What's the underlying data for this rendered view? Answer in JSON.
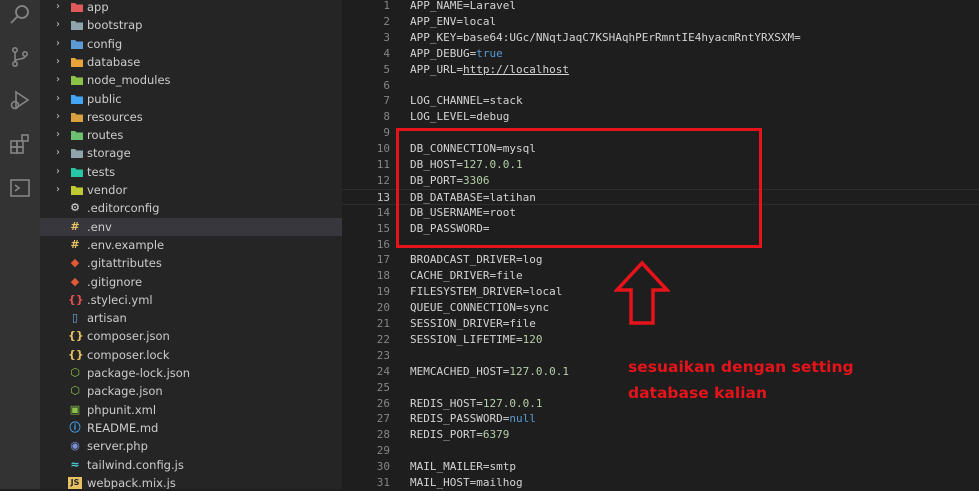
{
  "activity_bar": {
    "icons": [
      "search-icon",
      "source-control-icon",
      "run-debug-icon",
      "extensions-icon",
      "remote-explorer-icon"
    ]
  },
  "explorer": {
    "folders": [
      {
        "name": "app",
        "color": "#e05a5a"
      },
      {
        "name": "bootstrap",
        "color": "#90a4ae"
      },
      {
        "name": "config",
        "color": "#5c9bd6"
      },
      {
        "name": "database",
        "color": "#e8a33a"
      },
      {
        "name": "node_modules",
        "color": "#8bc34a"
      },
      {
        "name": "public",
        "color": "#42a5f5"
      },
      {
        "name": "resources",
        "color": "#d9a13e"
      },
      {
        "name": "routes",
        "color": "#6fbf73"
      },
      {
        "name": "storage",
        "color": "#90a4ae"
      },
      {
        "name": "tests",
        "color": "#26c6a6"
      },
      {
        "name": "vendor",
        "color": "#c0ca33"
      }
    ],
    "files": [
      {
        "name": ".editorconfig",
        "icon": "gear-icon",
        "color": "#e0e0e0",
        "glyph": "⚙"
      },
      {
        "name": ".env",
        "icon": "env-icon",
        "color": "#e8c163",
        "glyph": "#",
        "selected": true
      },
      {
        "name": ".env.example",
        "icon": "env-icon",
        "color": "#e8c163",
        "glyph": "#"
      },
      {
        "name": ".gitattributes",
        "icon": "git-icon",
        "color": "#e35935",
        "glyph": "◆"
      },
      {
        "name": ".gitignore",
        "icon": "git-icon",
        "color": "#e35935",
        "glyph": "◆"
      },
      {
        "name": ".styleci.yml",
        "icon": "yaml-icon",
        "color": "#e35050",
        "glyph": "{}"
      },
      {
        "name": "artisan",
        "icon": "file-icon",
        "color": "#6ea6dc",
        "glyph": "▯"
      },
      {
        "name": "composer.json",
        "icon": "json-icon",
        "color": "#e8c163",
        "glyph": "{}"
      },
      {
        "name": "composer.lock",
        "icon": "json-icon",
        "color": "#e8c163",
        "glyph": "{}"
      },
      {
        "name": "package-lock.json",
        "icon": "npm-icon",
        "color": "#8bc34a",
        "glyph": "⬡"
      },
      {
        "name": "package.json",
        "icon": "npm-icon",
        "color": "#8bc34a",
        "glyph": "⬡"
      },
      {
        "name": "phpunit.xml",
        "icon": "xml-icon",
        "color": "#8bc34a",
        "glyph": "▣"
      },
      {
        "name": "README.md",
        "icon": "info-icon",
        "color": "#42a5f5",
        "glyph": "ⓘ"
      },
      {
        "name": "server.php",
        "icon": "php-icon",
        "color": "#7b8fd6",
        "glyph": "◉"
      },
      {
        "name": "tailwind.config.js",
        "icon": "tailwind-icon",
        "color": "#4dd0e1",
        "glyph": "≈"
      },
      {
        "name": "webpack.mix.js",
        "icon": "js-icon",
        "color": "#e8c163",
        "glyph": "JS"
      }
    ]
  },
  "editor": {
    "lines": [
      {
        "n": "1",
        "key": "APP_NAME=",
        "val": "Laravel",
        "kind": "text"
      },
      {
        "n": "2",
        "key": "APP_ENV=",
        "val": "local",
        "kind": "text"
      },
      {
        "n": "3",
        "key": "APP_KEY=",
        "val": "base64:UGc/NNqtJaqC7KSHAqhPErRmntIE4hyacmRntYRXSXM=",
        "kind": "text"
      },
      {
        "n": "4",
        "key": "APP_DEBUG=",
        "val": "true",
        "kind": "bool"
      },
      {
        "n": "5",
        "key": "APP_URL=",
        "val": "http://localhost",
        "kind": "url"
      },
      {
        "n": "6",
        "key": "",
        "val": "",
        "kind": "text"
      },
      {
        "n": "7",
        "key": "LOG_CHANNEL=",
        "val": "stack",
        "kind": "text"
      },
      {
        "n": "8",
        "key": "LOG_LEVEL=",
        "val": "debug",
        "kind": "text"
      },
      {
        "n": "9",
        "key": "",
        "val": "",
        "kind": "text"
      },
      {
        "n": "10",
        "key": "DB_CONNECTION=",
        "val": "mysql",
        "kind": "text"
      },
      {
        "n": "11",
        "key": "DB_HOST=",
        "val": "127.0.0.1",
        "kind": "num"
      },
      {
        "n": "12",
        "key": "DB_PORT=",
        "val": "3306",
        "kind": "num"
      },
      {
        "n": "13",
        "key": "DB_DATABASE=",
        "val": "latihan",
        "kind": "text",
        "current": true
      },
      {
        "n": "14",
        "key": "DB_USERNAME=",
        "val": "root",
        "kind": "text"
      },
      {
        "n": "15",
        "key": "DB_PASSWORD=",
        "val": "",
        "kind": "text"
      },
      {
        "n": "16",
        "key": "",
        "val": "",
        "kind": "text"
      },
      {
        "n": "17",
        "key": "BROADCAST_DRIVER=",
        "val": "log",
        "kind": "text"
      },
      {
        "n": "18",
        "key": "CACHE_DRIVER=",
        "val": "file",
        "kind": "text"
      },
      {
        "n": "19",
        "key": "FILESYSTEM_DRIVER=",
        "val": "local",
        "kind": "text"
      },
      {
        "n": "20",
        "key": "QUEUE_CONNECTION=",
        "val": "sync",
        "kind": "text"
      },
      {
        "n": "21",
        "key": "SESSION_DRIVER=",
        "val": "file",
        "kind": "text"
      },
      {
        "n": "22",
        "key": "SESSION_LIFETIME=",
        "val": "120",
        "kind": "num"
      },
      {
        "n": "23",
        "key": "",
        "val": "",
        "kind": "text"
      },
      {
        "n": "24",
        "key": "MEMCACHED_HOST=",
        "val": "127.0.0.1",
        "kind": "num"
      },
      {
        "n": "25",
        "key": "",
        "val": "",
        "kind": "text"
      },
      {
        "n": "26",
        "key": "REDIS_HOST=",
        "val": "127.0.0.1",
        "kind": "num"
      },
      {
        "n": "27",
        "key": "REDIS_PASSWORD=",
        "val": "null",
        "kind": "bool"
      },
      {
        "n": "28",
        "key": "REDIS_PORT=",
        "val": "6379",
        "kind": "num"
      },
      {
        "n": "29",
        "key": "",
        "val": "",
        "kind": "text"
      },
      {
        "n": "30",
        "key": "MAIL_MAILER=",
        "val": "smtp",
        "kind": "text"
      },
      {
        "n": "31",
        "key": "MAIL_HOST=",
        "val": "mailhog",
        "kind": "text"
      }
    ]
  },
  "annotation": {
    "line1": "sesuaikan dengan setting",
    "line2": "database kalian",
    "color": "#e6131b"
  }
}
